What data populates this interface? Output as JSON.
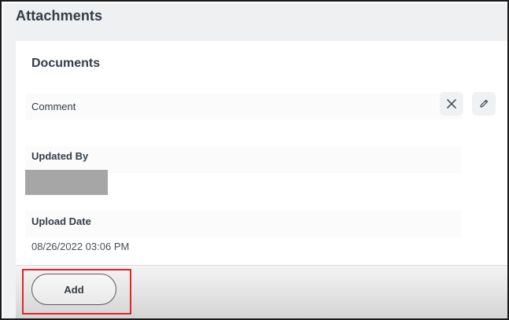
{
  "page": {
    "title": "Attachments"
  },
  "documents": {
    "section_title": "Documents",
    "comment_label": "Comment",
    "updated_by_label": "Updated By",
    "upload_date_label": "Upload Date",
    "upload_date_value": "08/26/2022 03:06 PM"
  },
  "actions": {
    "clear_icon": "close-icon",
    "edit_icon": "pencil-icon"
  },
  "footer": {
    "add_label": "Add"
  },
  "colors": {
    "highlight": "#e0262b",
    "text_primary": "#333d47"
  }
}
